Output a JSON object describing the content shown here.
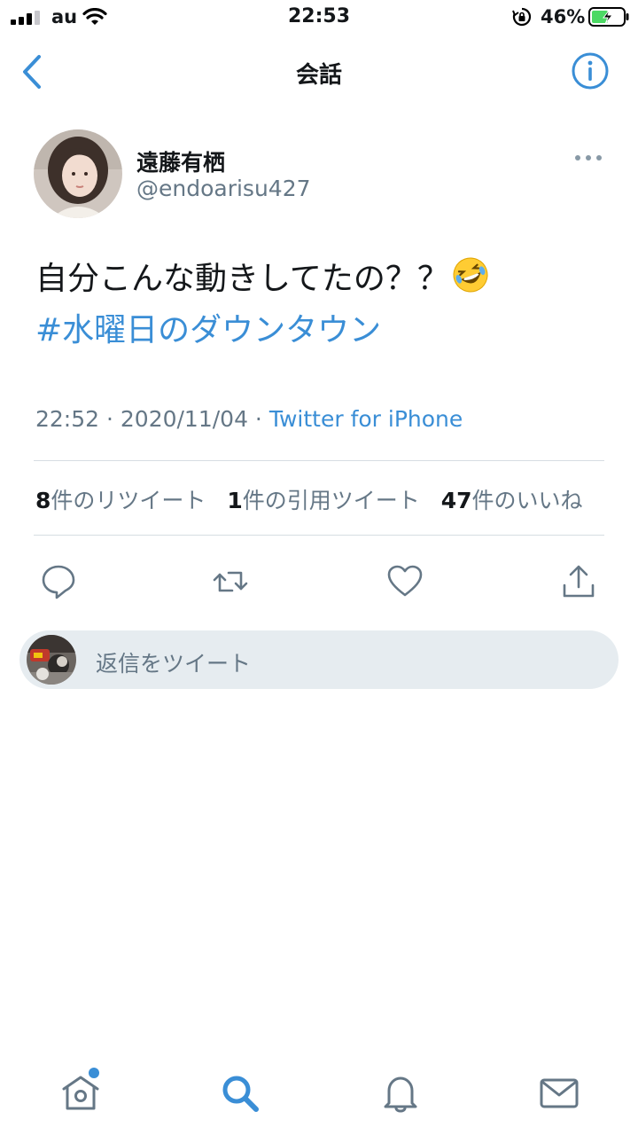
{
  "status_bar": {
    "carrier": "au",
    "time": "22:53",
    "battery_percent": "46%"
  },
  "nav": {
    "title": "会話"
  },
  "tweet": {
    "display_name": "遠藤有栖",
    "handle": "@endoarisu427",
    "text": "自分こんな動きしてたの？？",
    "hashtag": "#水曜日のダウンタウン",
    "time": "22:52",
    "separator": " · ",
    "date": "2020/11/04",
    "source": "Twitter for iPhone",
    "stats": {
      "retweets_count": "8",
      "retweets_label": "件のリツイート",
      "quotes_count": "1",
      "quotes_label": "件の引用ツイート",
      "likes_count": "47",
      "likes_label": "件のいいね"
    }
  },
  "reply": {
    "placeholder": "返信をツイート"
  },
  "colors": {
    "accent": "#3a8ed6",
    "muted": "#657786",
    "text": "#14171a",
    "reply_bg": "#e6ecf0"
  },
  "icons": {
    "back": "chevron-left-icon",
    "info": "info-icon",
    "more": "more-horizontal-icon",
    "reply": "reply-icon",
    "retweet": "retweet-icon",
    "like": "heart-icon",
    "share": "share-icon",
    "home": "home-icon",
    "search": "search-icon",
    "notifications": "bell-icon",
    "messages": "mail-icon",
    "emoji": "rofl-emoji"
  }
}
